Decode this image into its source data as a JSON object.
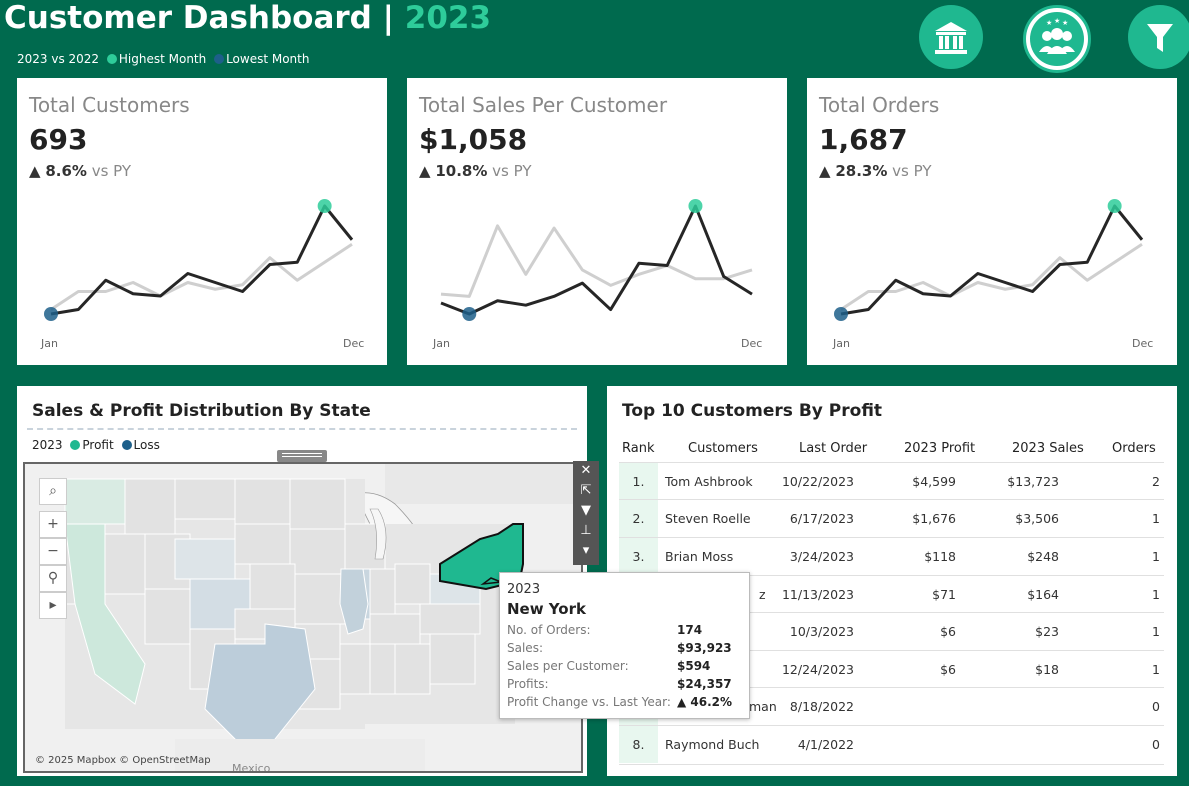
{
  "header": {
    "title": "Customer Dashboard | ",
    "year": "2023",
    "legend_prefix": "2023 vs 2022",
    "legend_high": "Highest Month",
    "legend_low": "Lowest Month",
    "colors": {
      "highest": "#2ecc9a",
      "lowest": "#1d5f8a",
      "background": "#006a4e"
    }
  },
  "nav": {
    "buttons": [
      {
        "icon": "bank-icon"
      },
      {
        "icon": "customers-group-icon"
      },
      {
        "icon": "filter-icon"
      }
    ]
  },
  "kpis": [
    {
      "title": "Total Customers",
      "value": "693",
      "arrow": "▲",
      "change": "8.6%",
      "vs": "vs PY",
      "x_start": "Jan",
      "x_end": "Dec",
      "current": [
        12,
        14,
        27,
        21,
        20,
        30,
        26,
        22,
        34,
        35,
        60,
        45
      ],
      "previous": [
        14,
        22,
        22,
        26,
        20,
        26,
        23,
        25,
        37,
        27,
        35,
        43
      ],
      "max_month": 11,
      "min_month": 1
    },
    {
      "title": "Total Sales Per Customer",
      "value": "$1,058",
      "arrow": "▲",
      "change": "10.8%",
      "vs": "vs PY",
      "x_start": "Jan",
      "x_end": "Dec",
      "current": [
        1010,
        960,
        1020,
        1000,
        1040,
        1100,
        980,
        1190,
        1180,
        1450,
        1130,
        1050
      ],
      "previous": [
        1050,
        1040,
        1360,
        1140,
        1350,
        1160,
        1090,
        1140,
        1180,
        1120,
        1120,
        1160
      ],
      "max_month": 10,
      "min_month": 2
    },
    {
      "title": "Total Orders",
      "value": "1,687",
      "arrow": "▲",
      "change": "28.3%",
      "vs": "vs PY",
      "x_start": "Jan",
      "x_end": "Dec",
      "current": [
        12,
        14,
        27,
        21,
        20,
        30,
        26,
        22,
        34,
        35,
        60,
        45
      ],
      "previous": [
        14,
        22,
        22,
        26,
        20,
        26,
        23,
        25,
        37,
        27,
        35,
        43
      ],
      "max_month": 11,
      "min_month": 1
    }
  ],
  "map_panel": {
    "title": "Sales & Profit Distribution By State",
    "legend_year": "2023",
    "legend_profit": "Profit",
    "legend_loss": "Loss",
    "credit": "© 2025 Mapbox © OpenStreetMap",
    "mexico_label": "Mexico",
    "colors": {
      "profit": "#1fb890",
      "loss": "#1d5f8a"
    },
    "tooltip": {
      "year": "2023",
      "state": "New York",
      "rows": [
        {
          "label": "No. of Orders:",
          "value": "174"
        },
        {
          "label": "Sales:",
          "value": "$93,923"
        },
        {
          "label": "Sales per Customer:",
          "value": "$594"
        },
        {
          "label": "Profits:",
          "value": "$24,357"
        },
        {
          "label": "Profit Change vs. Last Year:",
          "value": "▲ 46.2%"
        }
      ]
    }
  },
  "table_panel": {
    "title": "Top 10 Customers By Profit",
    "columns": [
      "Rank",
      "Customers",
      "Last Order",
      "2023 Profit",
      "2023 Sales",
      "Orders"
    ],
    "rows": [
      {
        "rank": "1.",
        "customer": "Tom Ashbrook",
        "last_order": "10/22/2023",
        "profit": "$4,599",
        "sales": "$13,723",
        "orders": "2"
      },
      {
        "rank": "2.",
        "customer": "Steven Roelle",
        "last_order": "6/17/2023",
        "profit": "$1,676",
        "sales": "$3,506",
        "orders": "1"
      },
      {
        "rank": "3.",
        "customer": "Brian Moss",
        "last_order": "3/24/2023",
        "profit": "$118",
        "sales": "$248",
        "orders": "1"
      },
      {
        "rank": "",
        "customer": "z",
        "last_order": "11/13/2023",
        "profit": "$71",
        "sales": "$164",
        "orders": "1"
      },
      {
        "rank": "",
        "customer": "",
        "last_order": "10/3/2023",
        "profit": "$6",
        "sales": "$23",
        "orders": "1"
      },
      {
        "rank": "",
        "customer": "",
        "last_order": "12/24/2023",
        "profit": "$6",
        "sales": "$18",
        "orders": "1"
      },
      {
        "rank": "",
        "customer": "man",
        "last_order": "8/18/2022",
        "profit": "",
        "sales": "",
        "orders": "0"
      },
      {
        "rank": "8.",
        "customer": "Raymond Buch",
        "last_order": "4/1/2022",
        "profit": "",
        "sales": "",
        "orders": "0"
      }
    ]
  }
}
